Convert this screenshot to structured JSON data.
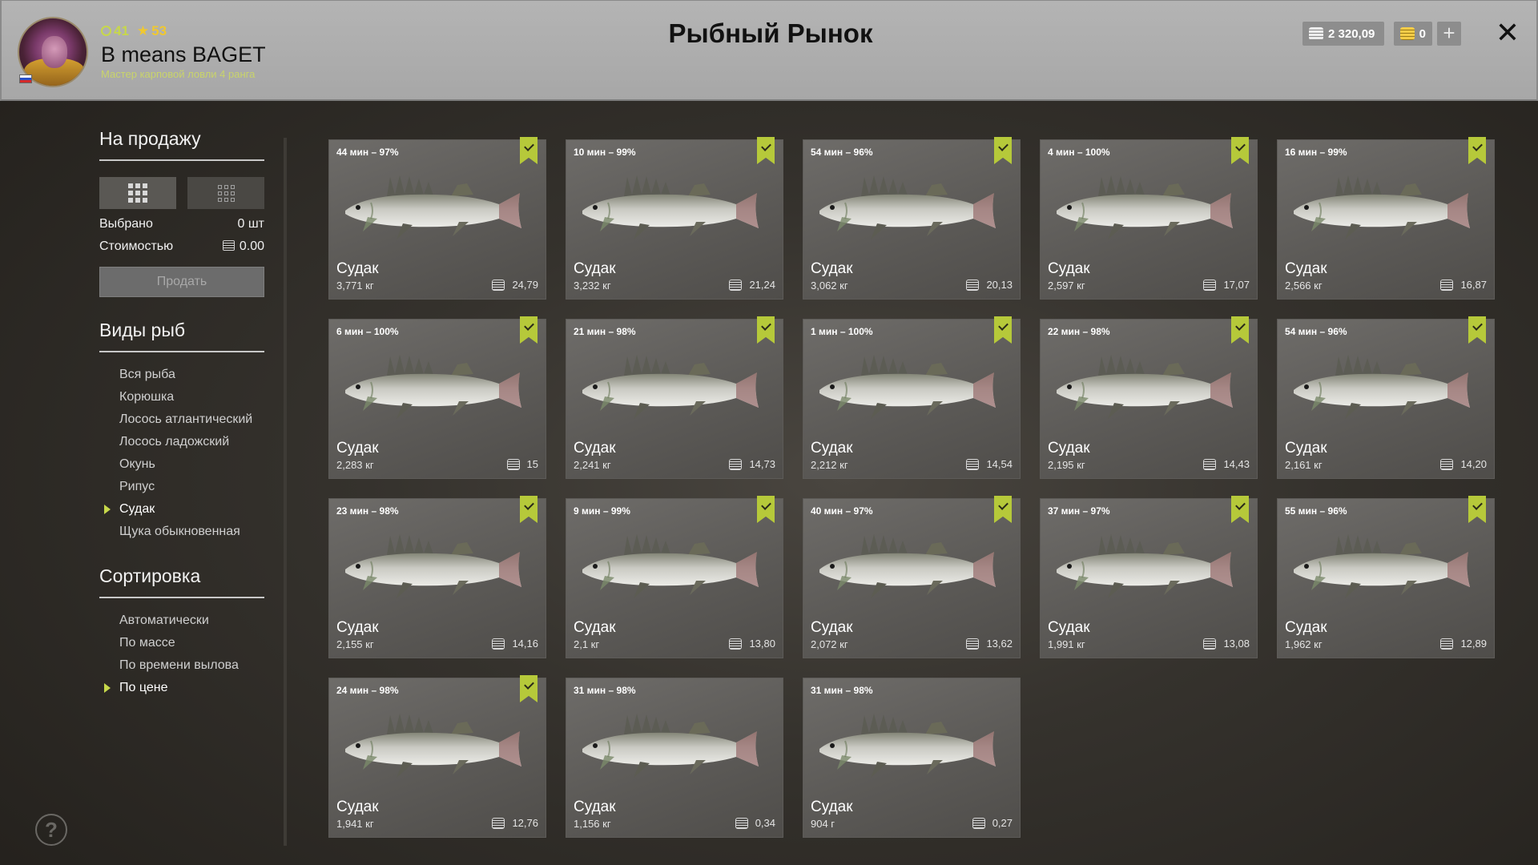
{
  "header": {
    "level": "41",
    "rank": "53",
    "username": "B means BAGET",
    "subtitle": "Мастер карповой ловли 4 ранга",
    "title": "Рыбный Рынок",
    "silver": "2 320,09",
    "gold": "0",
    "add_label": "+",
    "close_label": "✕"
  },
  "sidebar": {
    "sale_title": "На продажу",
    "selected_label": "Выбрано",
    "selected_value": "0 шт",
    "cost_label": "Стоимостью",
    "cost_value": "0.00",
    "sell_label": "Продать",
    "species_title": "Виды рыб",
    "species": [
      {
        "label": "Вся рыба",
        "active": false
      },
      {
        "label": "Корюшка",
        "active": false
      },
      {
        "label": "Лосось атлантический",
        "active": false
      },
      {
        "label": "Лосось ладожский",
        "active": false
      },
      {
        "label": "Окунь",
        "active": false
      },
      {
        "label": "Рипус",
        "active": false
      },
      {
        "label": "Судак",
        "active": true
      },
      {
        "label": "Щука обыкновенная",
        "active": false
      }
    ],
    "sort_title": "Сортировка",
    "sort": [
      {
        "label": "Автоматически",
        "active": false
      },
      {
        "label": "По массе",
        "active": false
      },
      {
        "label": "По времени вылова",
        "active": false
      },
      {
        "label": "По цене",
        "active": true
      }
    ],
    "help_label": "?"
  },
  "fish": [
    {
      "time": "44 мин – 97%",
      "name": "Судак",
      "weight": "3,771 кг",
      "price": "24,79",
      "marked": true
    },
    {
      "time": "10 мин – 99%",
      "name": "Судак",
      "weight": "3,232 кг",
      "price": "21,24",
      "marked": true
    },
    {
      "time": "54 мин – 96%",
      "name": "Судак",
      "weight": "3,062 кг",
      "price": "20,13",
      "marked": true
    },
    {
      "time": "4 мин – 100%",
      "name": "Судак",
      "weight": "2,597 кг",
      "price": "17,07",
      "marked": true
    },
    {
      "time": "16 мин – 99%",
      "name": "Судак",
      "weight": "2,566 кг",
      "price": "16,87",
      "marked": true
    },
    {
      "time": "6 мин – 100%",
      "name": "Судак",
      "weight": "2,283 кг",
      "price": "15",
      "marked": true
    },
    {
      "time": "21 мин – 98%",
      "name": "Судак",
      "weight": "2,241 кг",
      "price": "14,73",
      "marked": true
    },
    {
      "time": "1 мин – 100%",
      "name": "Судак",
      "weight": "2,212 кг",
      "price": "14,54",
      "marked": true
    },
    {
      "time": "22 мин – 98%",
      "name": "Судак",
      "weight": "2,195 кг",
      "price": "14,43",
      "marked": true
    },
    {
      "time": "54 мин – 96%",
      "name": "Судак",
      "weight": "2,161 кг",
      "price": "14,20",
      "marked": true
    },
    {
      "time": "23 мин – 98%",
      "name": "Судак",
      "weight": "2,155 кг",
      "price": "14,16",
      "marked": true
    },
    {
      "time": "9 мин – 99%",
      "name": "Судак",
      "weight": "2,1 кг",
      "price": "13,80",
      "marked": true
    },
    {
      "time": "40 мин – 97%",
      "name": "Судак",
      "weight": "2,072 кг",
      "price": "13,62",
      "marked": true
    },
    {
      "time": "37 мин – 97%",
      "name": "Судак",
      "weight": "1,991 кг",
      "price": "13,08",
      "marked": true
    },
    {
      "time": "55 мин – 96%",
      "name": "Судак",
      "weight": "1,962 кг",
      "price": "12,89",
      "marked": true
    },
    {
      "time": "24 мин – 98%",
      "name": "Судак",
      "weight": "1,941 кг",
      "price": "12,76",
      "marked": true
    },
    {
      "time": "31 мин – 98%",
      "name": "Судак",
      "weight": "1,156 кг",
      "price": "0,34",
      "marked": false
    },
    {
      "time": "31 мин – 98%",
      "name": "Судак",
      "weight": "904 г",
      "price": "0,27",
      "marked": false
    }
  ]
}
